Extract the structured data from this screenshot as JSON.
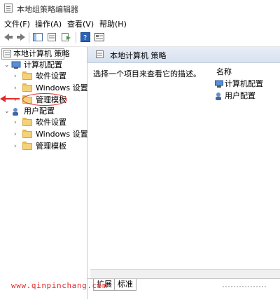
{
  "window": {
    "title": "本地组策略编辑器"
  },
  "menu": [
    "文件(F)",
    "操作(A)",
    "查看(V)",
    "帮助(H)"
  ],
  "toolbar": {
    "buttons": [
      "back-icon",
      "forward-icon",
      "show-hide-tree-icon",
      "properties-icon",
      "export-list-icon",
      "help-icon",
      "view-icon"
    ]
  },
  "tree": {
    "root": "本地计算机 策略",
    "computer": {
      "label": "计算机配置",
      "children": [
        "软件设置",
        "Windows 设置",
        "管理模板"
      ]
    },
    "user": {
      "label": "用户配置",
      "children": [
        "软件设置",
        "Windows 设置",
        "管理模板"
      ]
    }
  },
  "details": {
    "header": "本地计算机 策略",
    "description": "选择一个项目来查看它的描述。",
    "column": "名称",
    "items": [
      "计算机配置",
      "用户配置"
    ]
  },
  "tabs": [
    "扩展",
    "标准"
  ],
  "watermark": "www.qinpinchang.com",
  "colors": {
    "accent_red": "#e32b2b",
    "header_band": "#d7e1ef"
  }
}
